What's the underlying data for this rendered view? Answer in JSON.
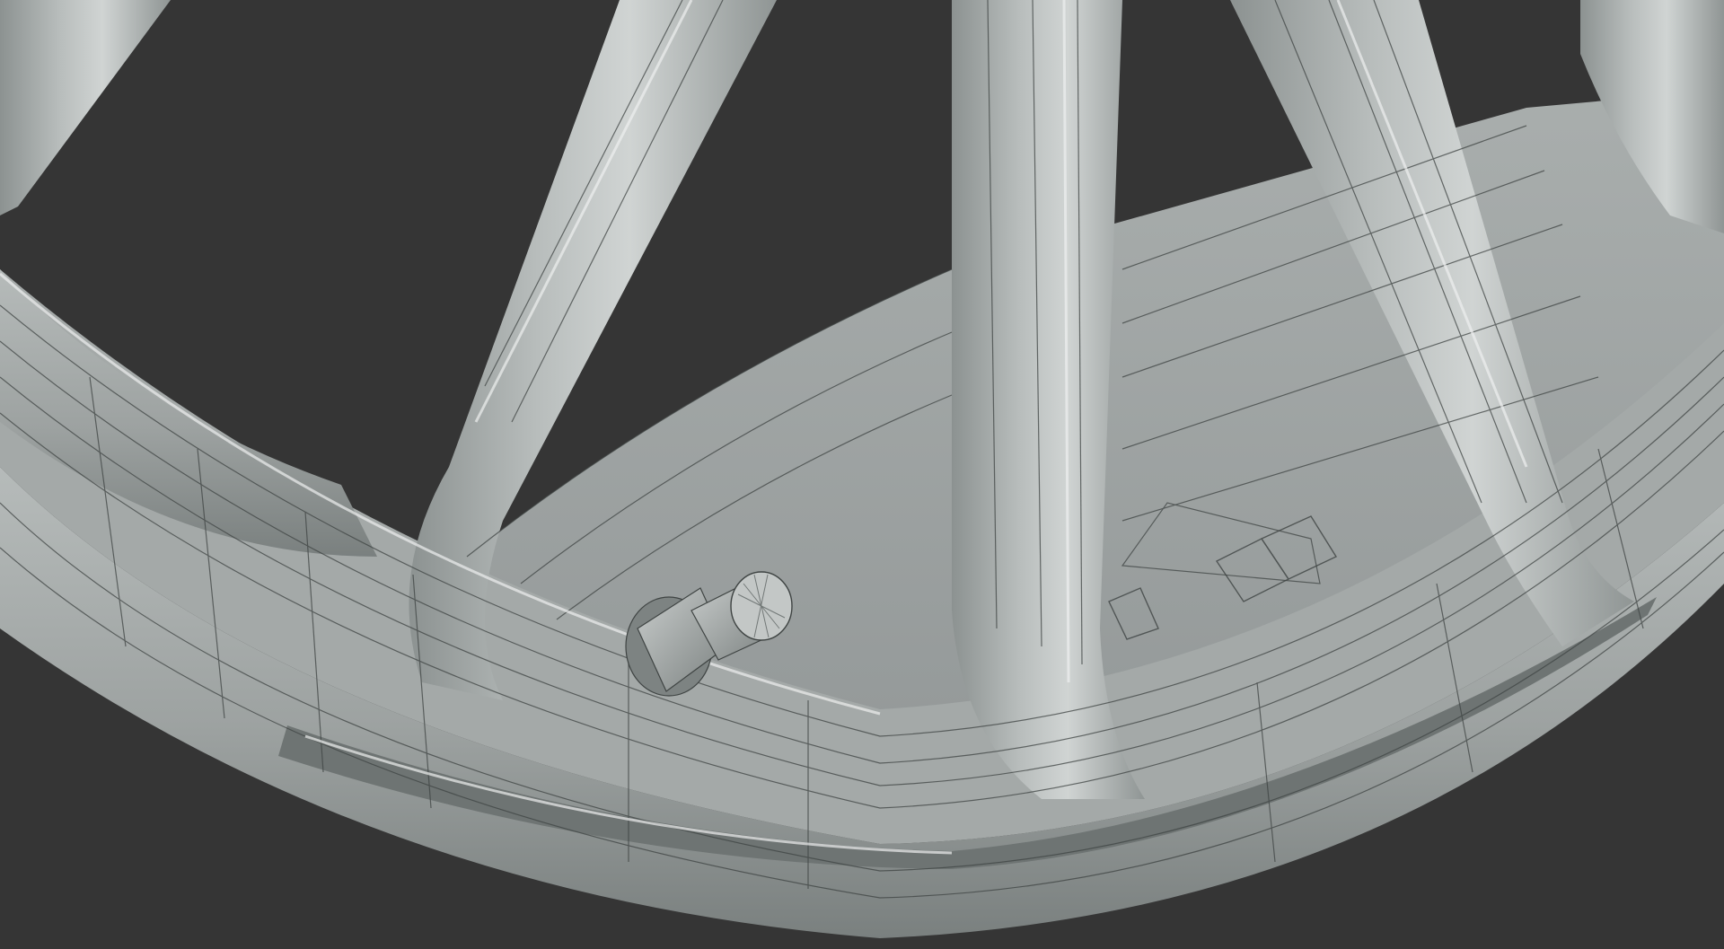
{
  "viewport": {
    "background_color": "#353535",
    "surface_color": "#a5aaa9",
    "surface_dark_color": "#7f8584",
    "surface_light_color": "#d3d7d6",
    "wire_color": "#3f4443",
    "highlight_color": "#eef0ef"
  },
  "model": {
    "components": [
      "wheel-rim",
      "spoke",
      "barrel",
      "valve-stem"
    ]
  }
}
